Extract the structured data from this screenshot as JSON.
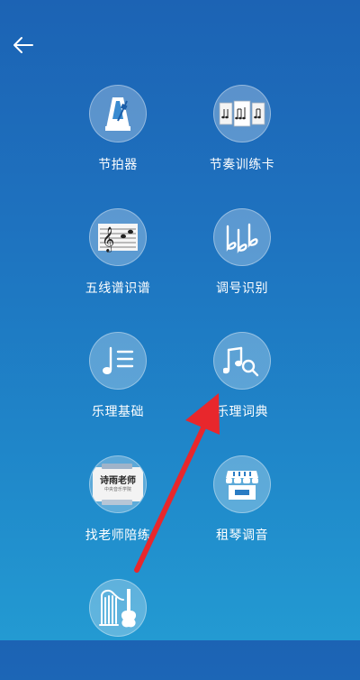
{
  "nav": {
    "back_icon": "back-arrow-icon"
  },
  "tools": [
    {
      "label": "节拍器",
      "icon": "metronome-icon"
    },
    {
      "label": "节奏训练卡",
      "icon": "rhythm-cards-icon"
    },
    {
      "label": "五线谱识谱",
      "icon": "staff-treble-clef-icon"
    },
    {
      "label": "调号识别",
      "icon": "key-signature-flats-icon"
    },
    {
      "label": "乐理基础",
      "icon": "music-note-list-icon"
    },
    {
      "label": "乐理词典",
      "icon": "music-note-search-icon"
    },
    {
      "label": "找老师陪练",
      "icon": "teacher-card-icon"
    },
    {
      "label": "租琴调音",
      "icon": "piano-shop-icon"
    },
    {
      "label": "",
      "icon": "instruments-icon"
    }
  ],
  "teacher_card": {
    "name": "诗雨老师",
    "school": "中央音乐学院"
  },
  "annotation": {
    "arrow_color": "#e8272c"
  },
  "colors": {
    "bg_top": "#1c63b4",
    "bg_bottom": "#239ad2",
    "text": "#ffffff"
  }
}
